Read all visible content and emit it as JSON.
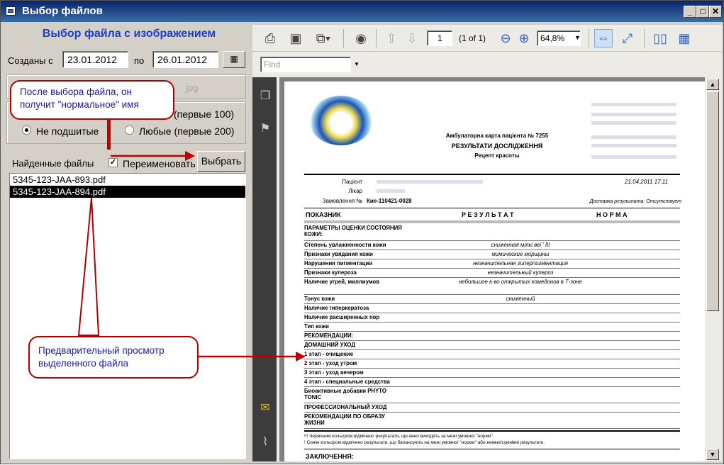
{
  "window": {
    "title": "Выбор файлов"
  },
  "left": {
    "heading": "Выбор файла с изображением",
    "created_from_label": "Созданы с",
    "date_from": "23.01.2012",
    "to_label": "по",
    "date_to": "26.01.2012",
    "ext_hint": "jpg",
    "radio_first100": "(первые 100)",
    "radio_unstitched": "Не подшитые",
    "radio_any": "Любые (первые 200)",
    "found_label": "Найденные файлы",
    "rename_label": "Переименовать",
    "select_button": "Выбрать",
    "files": [
      "5345-123-JAA-893.pdf",
      "5345-123-JAA-894.pdf"
    ]
  },
  "callouts": {
    "rename_note": "После выбора файла, он получит \"нормальное\" имя",
    "preview_note": "Предварительный просмотр выделенного файла"
  },
  "viewer": {
    "page_num": "1",
    "page_of": "(1 of 1)",
    "zoom": "64,8%",
    "find_placeholder": "Find"
  },
  "document": {
    "card_title": "Амбулаторна карта пацієнта № 7255",
    "results_title": "РЕЗУЛЬТАТИ ДОСЛІДЖЕННЯ",
    "recipe": "Рецепт красоты",
    "date": "21.04.2011 17:11",
    "patient_label": "Пацієнт",
    "doctor_label": "Лікар",
    "order_label": "Замовлення №",
    "order_value": "Кие-110421-0028",
    "delivery": "Доставка результата: Отсутствует",
    "col_indicator": "ПОКАЗНИК",
    "col_result": "Р Е З У Л Ь Т А Т",
    "col_norm": "Н О Р М А",
    "rows": [
      {
        "name": "ПАРАМЕТРЫ ОЦЕНКИ СОСТОЯНИЯ КОЖИ:",
        "result": ""
      },
      {
        "name": "Степень увлажненности кожи",
        "result": "сниженная мілкі веї ' ІІІ"
      },
      {
        "name": "Признаки увядания кожи",
        "result": "мимические морщины"
      },
      {
        "name": "Нарушения пигментации",
        "result": "незначительная гиперпигментация"
      },
      {
        "name": "Признаки купероза",
        "result": "незначительный купероз"
      },
      {
        "name": "Наличие угрей, миллиумов",
        "result": "небольшое к-во открытых комедонов в Т-зоне"
      },
      {
        "name": "Тонус кожи",
        "result": "сниженный"
      },
      {
        "name": "Наличие гиперкератоза",
        "result": ""
      },
      {
        "name": "Наличие расширенных пор",
        "result": ""
      },
      {
        "name": "Тип кожи",
        "result": ""
      },
      {
        "name": "РЕКОМЕНДАЦИИ:",
        "result": ""
      },
      {
        "name": "ДОМАШНИЙ УХОД",
        "result": ""
      },
      {
        "name": "1 этап - очищение",
        "result": ""
      },
      {
        "name": "2 этап - уход утром",
        "result": ""
      },
      {
        "name": "3 этап - уход вечером",
        "result": ""
      },
      {
        "name": "4 этап - специальные средства",
        "result": ""
      },
      {
        "name": "Биоактивные добавки PHYTO TONIC",
        "result": ""
      },
      {
        "name": "ПРОФЕССИОНАЛЬНЫЙ УХОД",
        "result": ""
      },
      {
        "name": "РЕКОМЕНДАЦИИ ПО ОБРАЗУ ЖИЗНИ",
        "result": ""
      }
    ],
    "note1": "!!! Червоним кольором відмічено результати, що явно виходять за межі умовної \"норми\".",
    "note2": "!  Синім кольором відмічено результати, що балансують на межі умовної \"норми\" або неявні/сумнівні результати.",
    "conclusion": "ЗАКЛЮЧЕННЯ:"
  }
}
